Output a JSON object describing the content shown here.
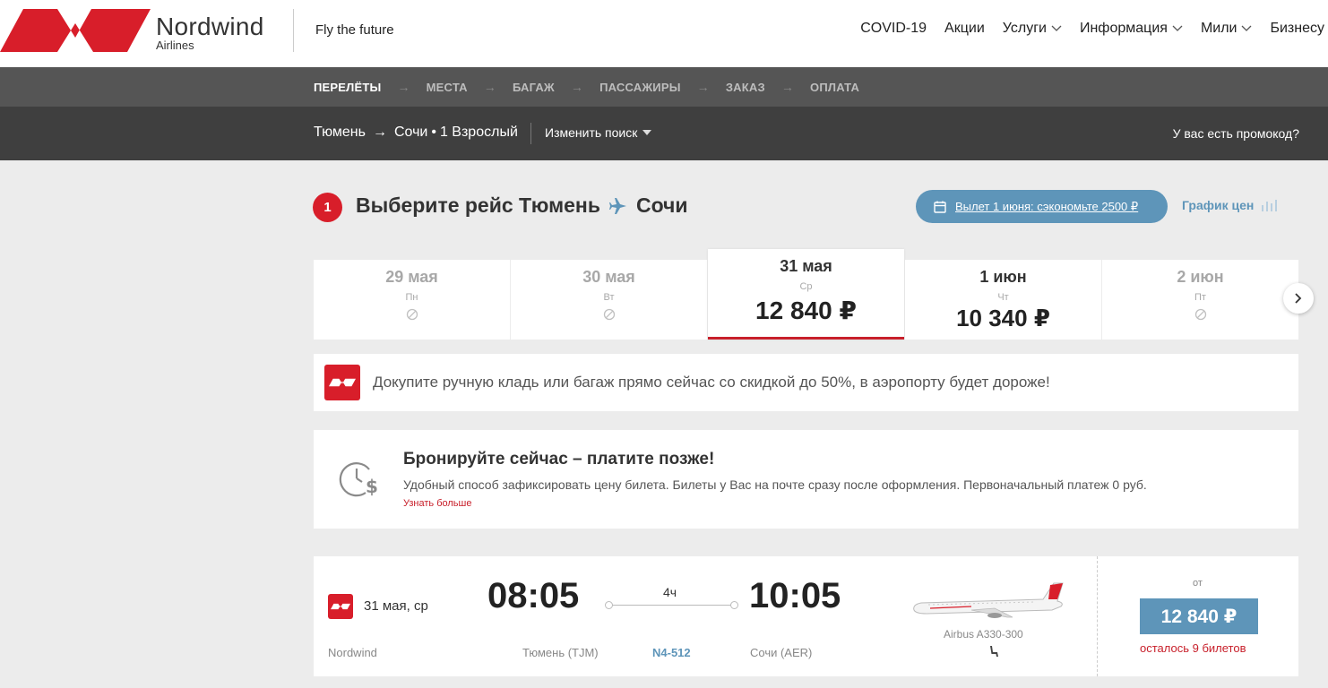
{
  "header": {
    "brand_name": "Nordwind",
    "brand_sub": "Airlines",
    "tagline": "Fly the future",
    "nav": [
      {
        "label": "COVID-19",
        "dropdown": false
      },
      {
        "label": "Акции",
        "dropdown": false
      },
      {
        "label": "Услуги",
        "dropdown": true
      },
      {
        "label": "Информация",
        "dropdown": true
      },
      {
        "label": "Мили",
        "dropdown": true
      },
      {
        "label": "Бизнесу",
        "dropdown": false
      }
    ]
  },
  "steps": {
    "items": [
      "ПЕРЕЛЁТЫ",
      "МЕСТА",
      "БАГАЖ",
      "ПАССАЖИРЫ",
      "ЗАКАЗ",
      "ОПЛАТА"
    ],
    "active_index": 0
  },
  "search": {
    "from": "Тюмень",
    "to": "Сочи",
    "passengers": "1 Взрослый",
    "change_label": "Изменить поиск",
    "promo_label": "У вас есть промокод?"
  },
  "section": {
    "step_number": "1",
    "title_prefix": "Выберите рейс Тюмень",
    "title_suffix": "Сочи",
    "deal_label": "Вылет 1 июня: сэкономьте 2500 ₽",
    "price_graph_label": "График цен"
  },
  "dates": [
    {
      "date": "29 мая",
      "weekday": "Пн",
      "price": null,
      "state": "disabled"
    },
    {
      "date": "30 мая",
      "weekday": "Вт",
      "price": null,
      "state": "disabled"
    },
    {
      "date": "31 мая",
      "weekday": "Ср",
      "price": "12 840 ₽",
      "state": "selected"
    },
    {
      "date": "1 июн",
      "weekday": "Чт",
      "price": "10 340 ₽",
      "state": "available"
    },
    {
      "date": "2 июн",
      "weekday": "Пт",
      "price": null,
      "state": "disabled"
    }
  ],
  "banner": {
    "text": "Докупите ручную кладь или багаж прямо сейчас со скидкой до 50%, в аэропорту будет дороже!"
  },
  "bnpl": {
    "title": "Бронируйте сейчас – платите позже!",
    "description": "Удобный способ зафиксировать цену билета. Билеты у Вас на почте сразу после оформления. Первоначальный платеж 0 руб.",
    "more_label": "Узнать больше"
  },
  "flight": {
    "date": "31 мая, ср",
    "airline": "Nordwind",
    "departure_time": "08:05",
    "arrival_time": "10:05",
    "duration": "4ч",
    "departure_airport": "Тюмень (TJM)",
    "arrival_airport": "Сочи (AER)",
    "flight_number": "N4-512",
    "aircraft": "Airbus A330-300",
    "from_label": "от",
    "price": "12 840 ₽",
    "seats_left": "осталось 9 билетов"
  },
  "colors": {
    "brand_red": "#d81e2a",
    "accent_blue": "#5e95b9",
    "steps_bg": "#555555",
    "search_bg": "#3f3f3f"
  }
}
